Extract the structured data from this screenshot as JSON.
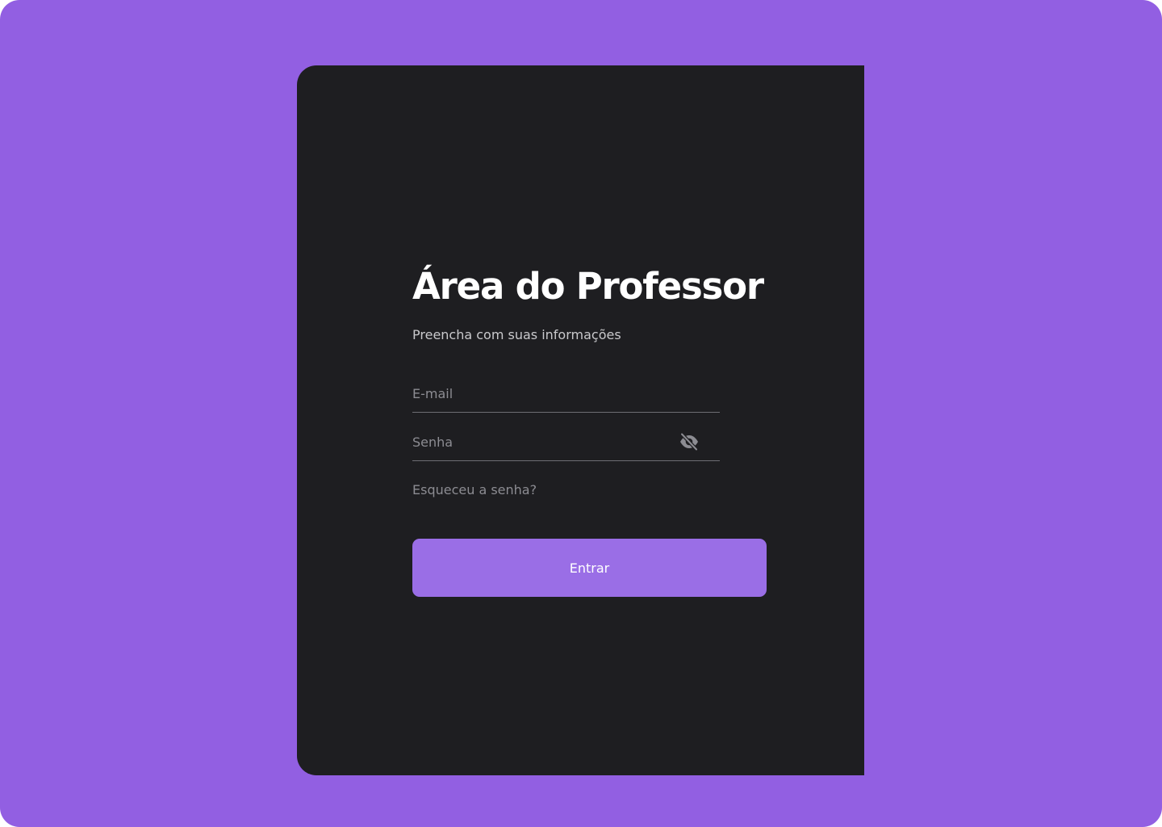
{
  "colors": {
    "background": "#925FE2",
    "card": "#1E1E21",
    "accent_button": "#9A6EE6",
    "title_text": "#FFFFFF",
    "subtitle_text": "#C9C9CC",
    "muted_text": "#8C8C92",
    "field_underline": "#6E6E73"
  },
  "login": {
    "title": "Área do Professor",
    "subtitle": "Preencha com suas informações",
    "email": {
      "placeholder": "E-mail",
      "value": ""
    },
    "password": {
      "placeholder": "Senha",
      "value": "",
      "toggle_icon": "eye-off-icon"
    },
    "forgot_link": "Esqueceu a senha?",
    "submit_label": "Entrar"
  }
}
